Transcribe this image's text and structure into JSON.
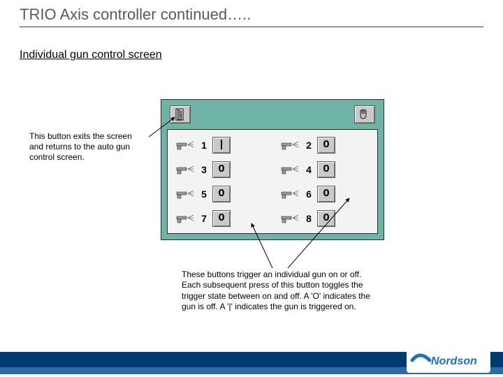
{
  "title": "TRIO Axis controller continued…..",
  "subtitle": "Individual gun control screen",
  "callout_left": "This button exits the screen and returns to the auto gun control screen.",
  "callout_bottom": "These buttons trigger an individual gun on or off. Each subsequent press of this button toggles the trigger state between on and off. A 'O' indicates the gun is off. A '|' indicates the gun is triggered on.",
  "panel": {
    "top_buttons": {
      "exit": "door-icon",
      "manual": "hand-icon"
    },
    "guns": [
      {
        "n": "1",
        "state": "|"
      },
      {
        "n": "2",
        "state": "O"
      },
      {
        "n": "3",
        "state": "O"
      },
      {
        "n": "4",
        "state": "O"
      },
      {
        "n": "5",
        "state": "O"
      },
      {
        "n": "6",
        "state": "O"
      },
      {
        "n": "7",
        "state": "O"
      },
      {
        "n": "8",
        "state": "O"
      }
    ]
  },
  "logo_text": "Nordson"
}
